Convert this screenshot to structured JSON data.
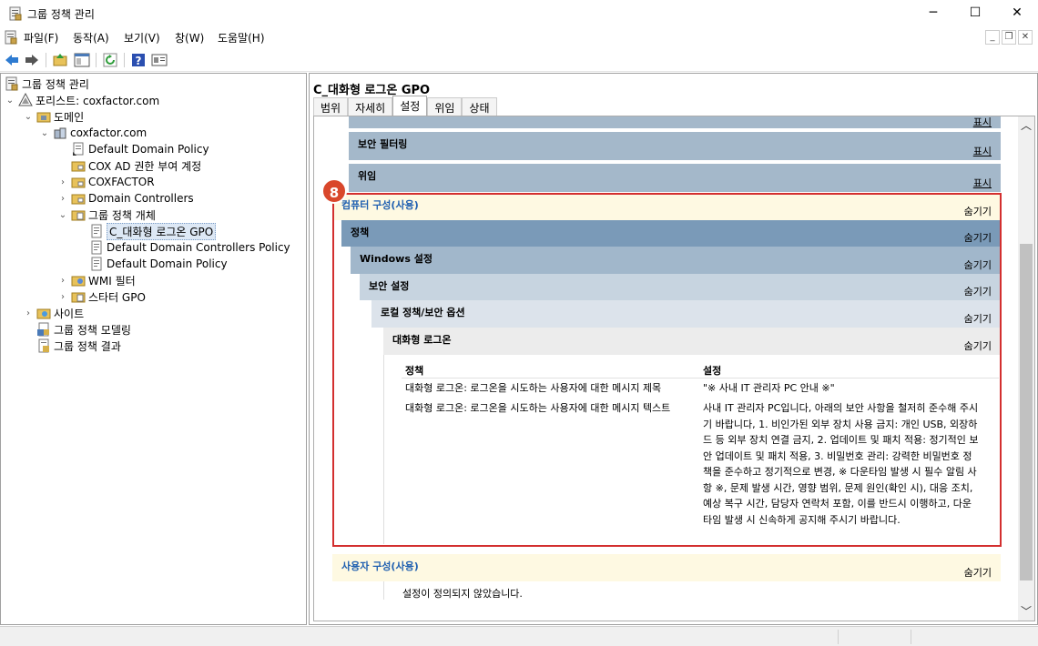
{
  "window": {
    "title": "그룹 정책 관리"
  },
  "menu": [
    "파일(F)",
    "동작(A)",
    "보기(V)",
    "창(W)",
    "도움말(H)"
  ],
  "tree": {
    "root": "그룹 정책 관리",
    "forest": "포리스트: coxfactor.com",
    "domains": "도메인",
    "domain": "coxfactor.com",
    "ddp_link": "Default Domain Policy",
    "cox_ad": "COX AD 권한 부여 계정",
    "coxfactor_ou": "COXFACTOR",
    "dc": "Domain Controllers",
    "gpo_objects": "그룹 정책 개체",
    "gpo_selected": "C_대화형 로그온 GPO",
    "gpo_ddcp": "Default Domain Controllers Policy",
    "gpo_ddp": "Default Domain Policy",
    "wmi": "WMI 필터",
    "starter": "스타터 GPO",
    "sites": "사이트",
    "modeling": "그룹 정책 모델링",
    "results": "그룹 정책 결과"
  },
  "right": {
    "gpo_title": "C_대화형 로그온 GPO",
    "tabs": [
      "범위",
      "자세히",
      "설정",
      "위임",
      "상태"
    ],
    "show_link": "표시",
    "hide_link": "숨기기",
    "security_filtering": "보안 필터링",
    "delegation": "위임",
    "computer_config": "컴퓨터 구성(사용)",
    "policies": "정책",
    "windows_settings": "Windows 설정",
    "security_settings": "보안 설정",
    "local_policies": "로컬 정책/보안 옵션",
    "interactive_logon": "대화형 로그온",
    "col_policy": "정책",
    "col_setting": "설정",
    "row1_policy": "대화형 로그온: 로그온을 시도하는 사용자에 대한 메시지 제목",
    "row1_setting": "\"※ 사내 IT 관리자 PC 안내 ※\"",
    "row2_policy": "대화형 로그온: 로그온을 시도하는 사용자에 대한 메시지 텍스트",
    "row2_setting": "사내 IT 관리자 PC입니다, 아래의 보안 사항을 철저히 준수해 주시기 바랍니다, 1. 비인가된 외부 장치 사용 금지: 개인 USB, 외장하드 등 외부 장치 연결 금지, 2. 업데이트 및 패치 적용: 정기적인 보안 업데이트 및 패치 적용, 3. 비밀번호 관리: 강력한 비밀번호 정책을 준수하고 정기적으로 변경, ※ 다운타임 발생 시 필수 알림 사항 ※, 문제 발생 시간, 영향 범위, 문제 원인(확인 시), 대응 조치, 예상 복구 시간, 담당자 연락처 포함, 이를 반드시 이행하고, 다운타임 발생 시 신속하게 공지해 주시기 바랍니다.",
    "user_config": "사용자 구성(사용)",
    "no_settings": "설정이 정의되지 않았습니다."
  },
  "annotation": {
    "badge": "8",
    "color": "#d32f2f"
  }
}
